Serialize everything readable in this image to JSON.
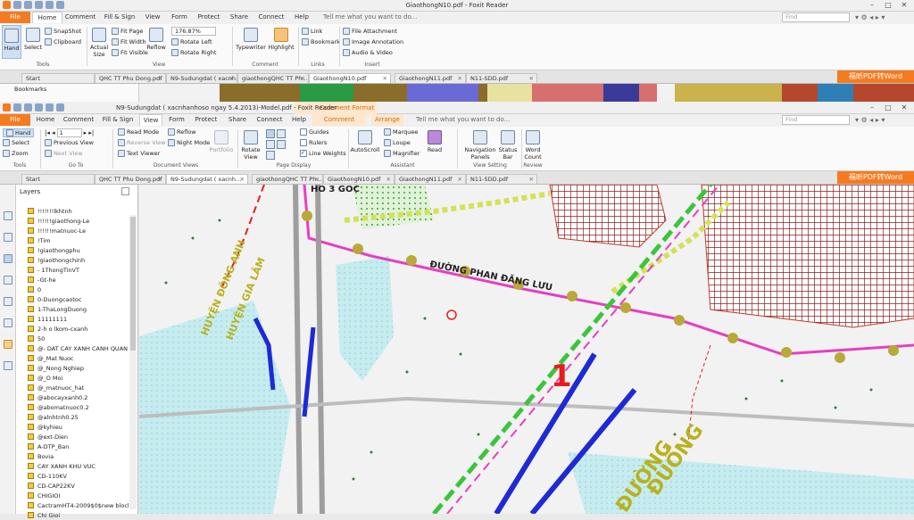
{
  "win1": {
    "title": "GiaothongN10.pdf - Foxit Reader",
    "menu": [
      "File",
      "Home",
      "Comment",
      "Fill & Sign",
      "View",
      "Form",
      "Protect",
      "Share",
      "Connect",
      "Help"
    ],
    "tell": "Tell me what you want to do...",
    "find": "Find",
    "ribbon": {
      "hand": "Hand",
      "select": "Select",
      "snapshot": "SnapShot",
      "clipboard": "Clipboard",
      "actual_size": "Actual Size",
      "fit_page": "Fit Page",
      "fit_width": "Fit Width",
      "fit_visible": "Fit Visible",
      "reflow": "Reflow",
      "zoom": "176.87%",
      "rotate_left": "Rotate Left",
      "rotate_right": "Rotate Right",
      "typewriter": "Typewriter",
      "highlight": "Highlight",
      "link": "Link",
      "bookmark": "Bookmark",
      "file_attachment": "File Attachment",
      "image_annotation": "Image Annotation",
      "audio_video": "Audio & Video",
      "groups": [
        "Tools",
        "View",
        "Comment",
        "Links",
        "Insert"
      ]
    },
    "tabs": [
      "Start",
      "QHC TT Phu Dong.pdf",
      "N9-Sudungdat ( xacnh...",
      "giaothongQHC TT Ph...",
      "GiaothongN10.pdf",
      "GiaothongN11.pdf",
      "N11-SDD.pdf"
    ],
    "promo": "福昕PDF转Word",
    "bookmarks": "Bookmarks"
  },
  "win2": {
    "title": "N9-Sudungdat ( xacnhanhoso ngay 5.4.2013)-Model.pdf - Foxit Reader",
    "context_tab": "Comment Format",
    "menu": [
      "File",
      "Home",
      "Comment",
      "Fill & Sign",
      "View",
      "Form",
      "Protect",
      "Share",
      "Connect",
      "Help",
      "Comment Format",
      "Arrange"
    ],
    "tell": "Tell me what you want to do...",
    "find": "Find",
    "ribbon": {
      "hand": "Hand",
      "select": "Select",
      "zoom": "Zoom",
      "page": "1",
      "previous_view": "Previous View",
      "next_view": "Next View",
      "read_mode": "Read Mode",
      "reverse_view": "Reverse View",
      "text_viewer": "Text Viewer",
      "reflow": "Reflow",
      "night_mode": "Night Mode",
      "portfolio": "Portfolio",
      "rotate_view": "Rotate View",
      "guides": "Guides",
      "rulers": "Rulers",
      "line_weights": "Line Weights",
      "autoscroll": "AutoScroll",
      "marquee": "Marquee",
      "loupe": "Loupe",
      "magnifier": "Magnifier",
      "read": "Read",
      "navigation_panels": "Navigation Panels",
      "status_bar": "Status Bar",
      "word_count": "Word Count",
      "groups": [
        "Tools",
        "Go To",
        "Document Views",
        "Page Display",
        "Assistant",
        "View Setting",
        "Review"
      ]
    },
    "tabs": [
      "Start",
      "QHC TT Phu Dong.pdf",
      "N9-Sudungdat ( xacnh...",
      "giaothongQHC TT Ph...",
      "GiaothongN10.pdf",
      "GiaothongN11.pdf",
      "N11-SDD.pdf"
    ],
    "promo": "福昕PDF转Word",
    "layers_title": "Layers",
    "layers": [
      "!!!!!!!lkhtnh",
      "!!!!!!giaothong-Le",
      "!!!!!!matnuoc-Le",
      "!Tim",
      "!giaothongphu",
      "!giaothongchinh",
      "- 1ThongTinVT",
      "-Gt-he",
      "0",
      "0-Duongcaotoc",
      "1-ThaLongDuong",
      "11111111",
      "2-h o lkom-cxanh",
      "50",
      "@- DAT CAY XANH CANH QUAN",
      "@_Mat Nuoc",
      "@_Nong Nghiep",
      "@_O Moi",
      "@_matnuoc_hat",
      "@abocayxanh0.2",
      "@abomatnuoc0.2",
      "@alnhtnh0.25",
      "@kyhieu",
      "@ext-Dien",
      "A-DTP_Ban",
      "Bovia",
      "CAY XANH KHU VUC",
      "CD-110KV",
      "CD-CAP22KV",
      "CHIGIOI",
      "CactramHT4-2009$0$new blocl",
      "Chi Gioi"
    ]
  },
  "map": {
    "road_label": "ĐƯỜNG PHAN ĐĂNG LƯU",
    "top_label": "HỒ 3 GÓC",
    "district1": "HUYỆN ĐÔNG ANH",
    "district2": "HUYỆN GIA LÂM",
    "marker": "1",
    "bottom_label": "ĐƯỜNG",
    "bottom_label2": "ĐUỐNG"
  },
  "colors": {
    "accent": "#f47b20",
    "map_bg": "#f2f2f2",
    "water": "#c6ecf0",
    "road_pink": "#e63fbf",
    "green": "#3cc43c",
    "blue": "#1d2ad6",
    "red": "#e41e1e",
    "olive": "#b8b21e"
  }
}
